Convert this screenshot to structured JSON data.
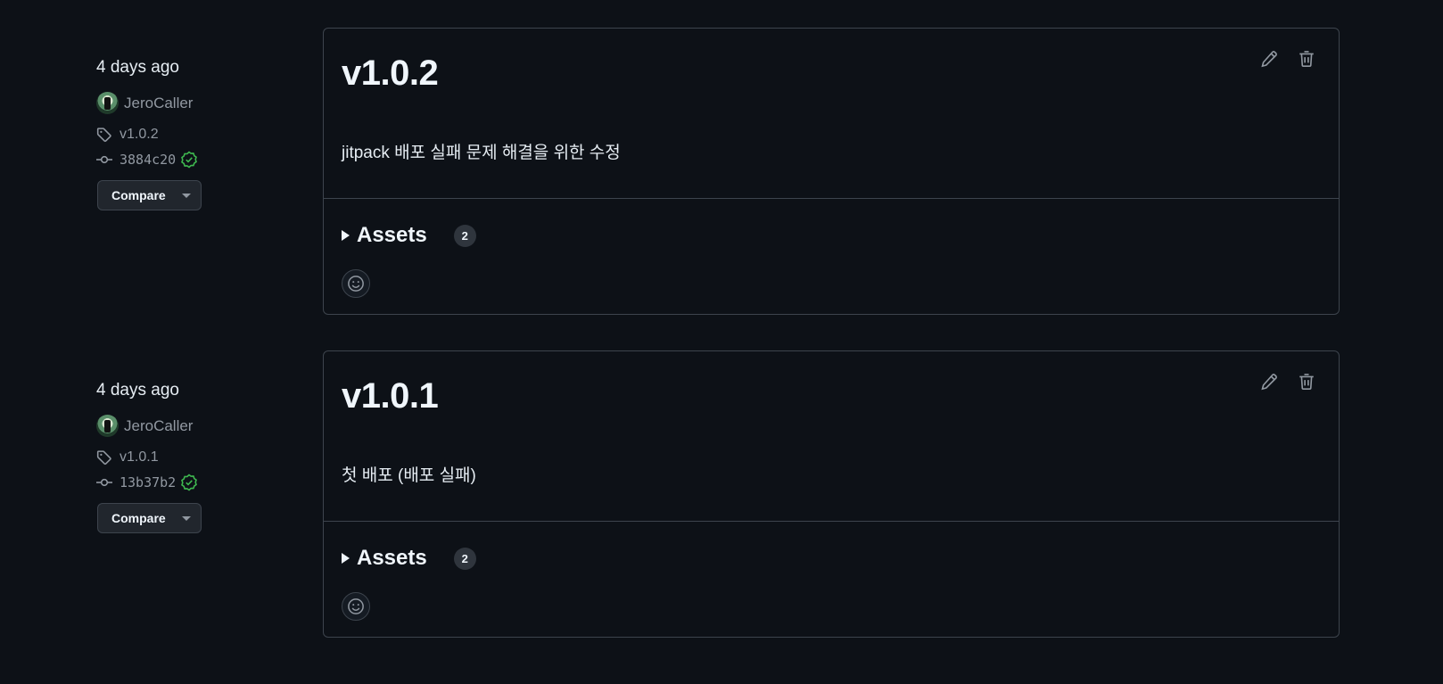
{
  "colors": {
    "background": "#0d1117",
    "border": "#3d444d",
    "text": "#e6edf3",
    "muted": "#9198a1",
    "verified": "#3fb950"
  },
  "releases": [
    {
      "date": "4 days ago",
      "author": "JeroCaller",
      "tag": "v1.0.2",
      "commit": "3884c20",
      "compare_label": "Compare",
      "title": "v1.0.2",
      "description": "jitpack 배포 실패 문제 해결을 위한 수정",
      "assets_label": "Assets",
      "assets_count": "2"
    },
    {
      "date": "4 days ago",
      "author": "JeroCaller",
      "tag": "v1.0.1",
      "commit": "13b37b2",
      "compare_label": "Compare",
      "title": "v1.0.1",
      "description": "첫 배포 (배포 실패)",
      "assets_label": "Assets",
      "assets_count": "2"
    }
  ]
}
